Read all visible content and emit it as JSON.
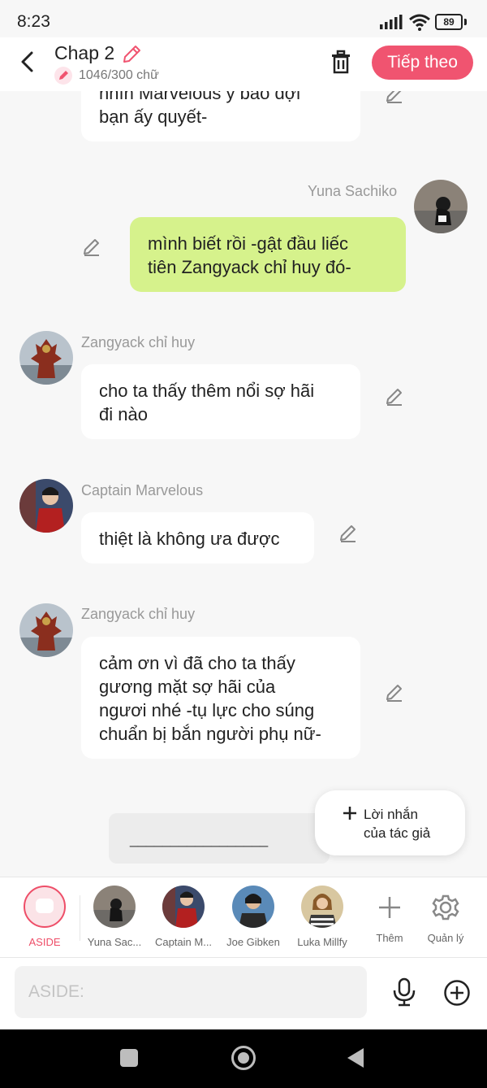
{
  "status": {
    "time": "8:23",
    "battery": "89"
  },
  "header": {
    "title": "Chap 2",
    "word_count": "1046/300 chữ",
    "next_label": "Tiếp theo"
  },
  "messages": [
    {
      "text_line1": "nhìn Marvelous ý bảo đợi",
      "text_line2": "bạn ấy quyết-"
    },
    {
      "speaker": "Yuna Sachiko",
      "text_line1": "mình biết rồi -gật đầu liếc",
      "text_line2": "tiên Zangyack chỉ huy đó-"
    },
    {
      "speaker": "Zangyack chỉ huy",
      "text_line1": "cho ta thấy thêm nổi sợ hãi",
      "text_line2": "đi nào"
    },
    {
      "speaker": "Captain Marvelous",
      "text_line1": "thiệt là không ưa được"
    },
    {
      "speaker": "Zangyack chỉ huy",
      "text_line1": "cảm ơn vì đã cho ta thấy",
      "text_line2": "gương mặt sợ hãi của",
      "text_line3": "ngươi nhé -tụ lực cho súng",
      "text_line4": "chuẩn bị bắn người phụ nữ-"
    }
  ],
  "divider_text": "_________________",
  "author_note": {
    "line1": "Lời nhắn",
    "line2": "của tác giả"
  },
  "characters": [
    {
      "label": "ASIDE"
    },
    {
      "label": "Yuna Sac..."
    },
    {
      "label": "Captain M..."
    },
    {
      "label": "Joe Gibken"
    },
    {
      "label": "Luka Millfy"
    },
    {
      "label": "Thêm"
    },
    {
      "label": "Quản lý"
    }
  ],
  "input": {
    "placeholder": "ASIDE:"
  },
  "colors": {
    "accent": "#f05470",
    "my_bubble": "#d6f28c",
    "background": "#f7f7f7"
  }
}
